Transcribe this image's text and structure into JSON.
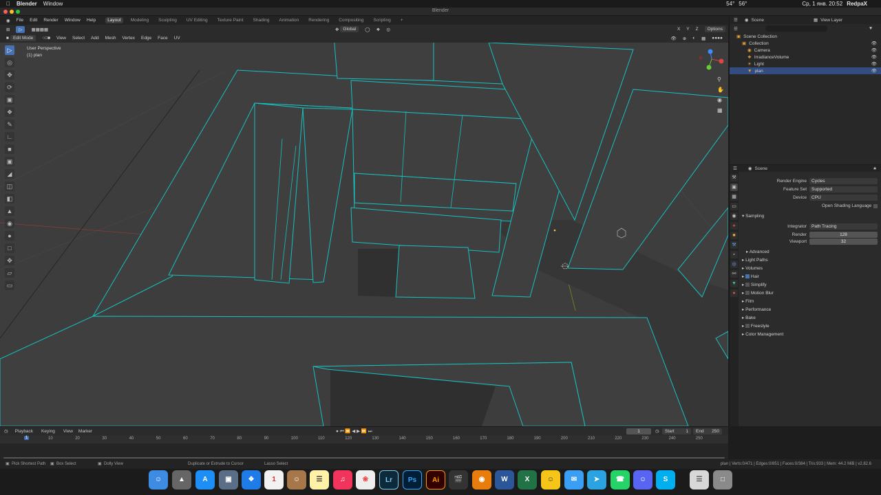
{
  "mac_menu": {
    "app": "Blender",
    "window": "Window",
    "temp1": "54°",
    "temp2": "56°",
    "clock": "Ср, 1 янв. 20:52",
    "user": "RedpaX"
  },
  "window_title": "Blender",
  "menus": [
    "File",
    "Edit",
    "Render",
    "Window",
    "Help"
  ],
  "workspaces": [
    "Layout",
    "Modeling",
    "Sculpting",
    "UV Editing",
    "Texture Paint",
    "Shading",
    "Animation",
    "Rendering",
    "Compositing",
    "Scripting"
  ],
  "active_workspace": "Layout",
  "header": {
    "transform": "Global",
    "options": "Options"
  },
  "header2": {
    "mode": "Edit Mode",
    "view": "View",
    "select": "Select",
    "add": "Add",
    "mesh": "Mesh",
    "vertex": "Vertex",
    "edge": "Edge",
    "face": "Face",
    "uv": "UV"
  },
  "viewport_info": {
    "perspective": "User Perspective",
    "object": "(1) plan"
  },
  "outliner": {
    "scene": "Scene",
    "view_layer": "View Layer",
    "items": [
      {
        "label": "Scene Collection",
        "indent": 0
      },
      {
        "label": "Collection",
        "indent": 1
      },
      {
        "label": "Camera",
        "indent": 2
      },
      {
        "label": "IrradianceVolume",
        "indent": 2
      },
      {
        "label": "Light",
        "indent": 2
      },
      {
        "label": "plan",
        "indent": 2,
        "selected": true
      }
    ]
  },
  "properties": {
    "scene": "Scene",
    "render_engine_label": "Render Engine",
    "render_engine": "Cycles",
    "feature_set_label": "Feature Set",
    "feature_set": "Supported",
    "device_label": "Device",
    "device": "CPU",
    "osl": "Open Shading Language",
    "sampling": "Sampling",
    "integrator_label": "Integrator",
    "integrator": "Path Tracing",
    "render_label": "Render",
    "render": "128",
    "viewport_label": "Viewport",
    "viewport": "32",
    "advanced": "Advanced",
    "light_paths": "Light Paths",
    "volumes": "Volumes",
    "hair": "Hair",
    "simplify": "Simplify",
    "motion_blur": "Motion Blur",
    "film": "Film",
    "performance": "Performance",
    "bake": "Bake",
    "freestyle": "Freestyle",
    "color_management": "Color Management"
  },
  "timeline": {
    "playback": "Playback",
    "keying": "Keying",
    "view": "View",
    "marker": "Marker",
    "current": "1",
    "start_label": "Start",
    "start": "1",
    "end_label": "End",
    "end": "250",
    "ticks": [
      "10",
      "20",
      "30",
      "40",
      "50",
      "60",
      "70",
      "80",
      "90",
      "100",
      "110",
      "120",
      "130",
      "140",
      "150",
      "160",
      "170",
      "180",
      "190",
      "200",
      "210",
      "220",
      "230",
      "240",
      "250"
    ],
    "playhead": "1"
  },
  "status": {
    "s1": "Pick Shortest Path",
    "s2": "Box Select",
    "s3": "Dolly View",
    "s4": "Duplicate or Extrude to Cursor",
    "s5": "Lasso Select",
    "stats": "plan | Verts:0/471 | Edges:0/851 | Faces:0/384 | Tris:933 | Mem: 44.2 MiB | v2.82.6"
  },
  "dock": [
    "Lr",
    "Ps",
    "Ai",
    "W",
    "X",
    "S"
  ],
  "colors": {
    "accent": "#4772b3",
    "mesh_edge": "#17c1c1",
    "viewport_bg": "#3d3d3d"
  }
}
